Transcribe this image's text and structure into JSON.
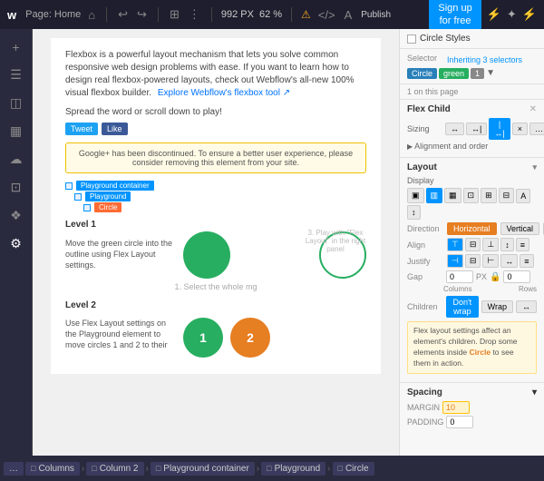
{
  "topbar": {
    "logo": "w",
    "page_label": "Page: Home",
    "icons": [
      "↩",
      "↪",
      "⊞",
      "⋮"
    ],
    "px_value": "992 PX",
    "zoom": "62 %",
    "warning_icon": "⚠",
    "code_icon": "</>",
    "publish_label": "Publish",
    "signup_line1": "Sign up",
    "signup_line2": "for free",
    "right_icons": [
      "⚡",
      "⊹",
      "⚡"
    ]
  },
  "left_sidebar": {
    "icons": [
      "✦",
      "+",
      "☰",
      "◫",
      "▦",
      "☁",
      "⊡",
      "❖",
      "⚙"
    ]
  },
  "canvas": {
    "intro_text": "Flexbox is a powerful layout mechanism that lets you solve common responsive web design problems with ease. If you want to learn how to design real flexbox-powered layouts, check out Webflow's all-new 100% visual flexbox builder.",
    "explore_link": "Explore Webflow's flexbox tool ↗",
    "spread_text": "Spread the word or scroll down to play!",
    "tweet_label": "Tweet",
    "like_label": "Like",
    "google_notice": "Google+ has been discontinued. To ensure a better user experience, please consider removing this element from your site.",
    "breadcrumbs": [
      {
        "label": "Playground container"
      },
      {
        "label": "Playground"
      },
      {
        "label": "Circle"
      }
    ],
    "level1": {
      "title": "Level 1",
      "description": "Move the green circle into the outline using Flex Layout settings."
    },
    "step1_hint": "1. Select the whole mg",
    "step2_hint": "3. Play with \"Flex Layout\" in the right panel",
    "level2": {
      "title": "Level 2",
      "description": "Use Flex Layout settings on the Playground element to move circles 1 and 2 to their",
      "circles": [
        {
          "number": "1",
          "color": "green"
        },
        {
          "number": "2",
          "color": "orange"
        }
      ]
    }
  },
  "bottom_bar": {
    "items": [
      "...",
      "Columns",
      "Column 2",
      "Playground container",
      "Playground",
      "Circle"
    ]
  },
  "right_panel": {
    "circle_styles_label": "Circle Styles",
    "selector_label": "Selector",
    "selector_inheriting": "Inheriting 3 selectors",
    "chips": [
      "Circle",
      "green",
      "1"
    ],
    "on_this_page": "1 on this page",
    "flex_child": {
      "title": "Flex Child",
      "sizing_buttons": [
        "↔",
        "↔|",
        "|↔|",
        "×",
        "…"
      ],
      "alignment_order": "Alignment and order"
    },
    "layout": {
      "title": "Layout",
      "display_label": "Display",
      "display_buttons": [
        "▣",
        "▥",
        "▦",
        "⊡",
        "⊞",
        "⊟",
        "A",
        "↕"
      ],
      "direction_label": "Direction",
      "direction_horizontal": "Horizontal",
      "direction_vertical": "Vertical",
      "align_label": "Align",
      "align_buttons": [
        "⊤",
        "⊟",
        "⊥",
        "↕",
        "≡"
      ],
      "justify_label": "Justify",
      "justify_buttons": [
        "⊣",
        "⊟",
        "⊢",
        "↔",
        "≡"
      ],
      "gap_label": "Gap",
      "gap_columns_value": "0",
      "gap_rows_value": "0",
      "gap_unit": "PX",
      "columns_label": "Columns",
      "rows_label": "Rows",
      "children_label": "Children",
      "wrap_off": "Don't wrap",
      "wrap_on": "Wrap"
    },
    "info_text": "Flex layout settings affect an element's children. Drop some elements inside",
    "info_highlight": "Circle",
    "info_text2": "to see them in action.",
    "spacing": {
      "title": "Spacing",
      "margin_label": "MARGIN",
      "margin_value": "10",
      "padding_label": "PADDING",
      "padding_value": "0"
    }
  }
}
